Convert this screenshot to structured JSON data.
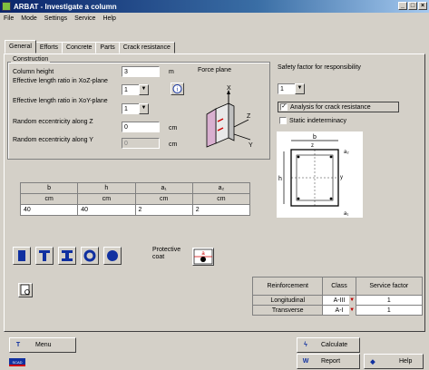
{
  "window": {
    "title": "ARBAT - Investigate a column"
  },
  "menu": [
    "File",
    "Mode",
    "Settings",
    "Service",
    "Help"
  ],
  "tabs": [
    "General",
    "Efforts",
    "Concrete",
    "Parts",
    "Crack resistance"
  ],
  "construction": {
    "group_title": "Construction",
    "column_height_label": "Column height",
    "column_height_value": "3",
    "column_height_unit": "m",
    "force_plane_label": "Force plane",
    "eff_length_xoz_label": "Effective length ratio in XoZ-plane",
    "eff_length_xoz_value": "1",
    "eff_length_xoy_label": "Effective length ratio in XoY-plane",
    "eff_length_xoy_value": "1",
    "random_ecc_z_label": "Random eccentricity along Z",
    "random_ecc_z_value": "0",
    "random_ecc_z_unit": "cm",
    "random_ecc_y_label": "Random eccentricity along Y",
    "random_ecc_y_value": "0",
    "random_ecc_y_unit": "cm",
    "axis_x": "X",
    "axis_y": "Y",
    "axis_z": "Z"
  },
  "section_table": {
    "headers": [
      "b",
      "h",
      "a₁",
      "a₂"
    ],
    "units": [
      "cm",
      "cm",
      "cm",
      "cm"
    ],
    "values": [
      "40",
      "40",
      "2",
      "2"
    ]
  },
  "safety": {
    "label": "Safety factor for responsibility",
    "value": "1",
    "analysis_crack_label": "Analysis for crack resistance",
    "analysis_crack_checked": true,
    "static_indet_label": "Static indeterminacy",
    "static_indet_checked": false
  },
  "section_drawing": {
    "b": "b",
    "h": "h",
    "z": "z",
    "y": "y",
    "a1": "a₁",
    "a2": "a₂"
  },
  "protective_coat_label": "Protective coat",
  "protective_coat_symbol": "a",
  "reinforcement": {
    "headers": [
      "Reinforcement",
      "Class",
      "Service factor"
    ],
    "rows": [
      {
        "name": "Longitudinal",
        "class": "A-III",
        "factor": "1"
      },
      {
        "name": "Transverse",
        "class": "A-I",
        "factor": "1"
      }
    ]
  },
  "bottom": {
    "menu_label": "Menu",
    "calculate_label": "Calculate",
    "report_label": "Report",
    "help_label": "Help",
    "flag_text": "SCAD"
  }
}
